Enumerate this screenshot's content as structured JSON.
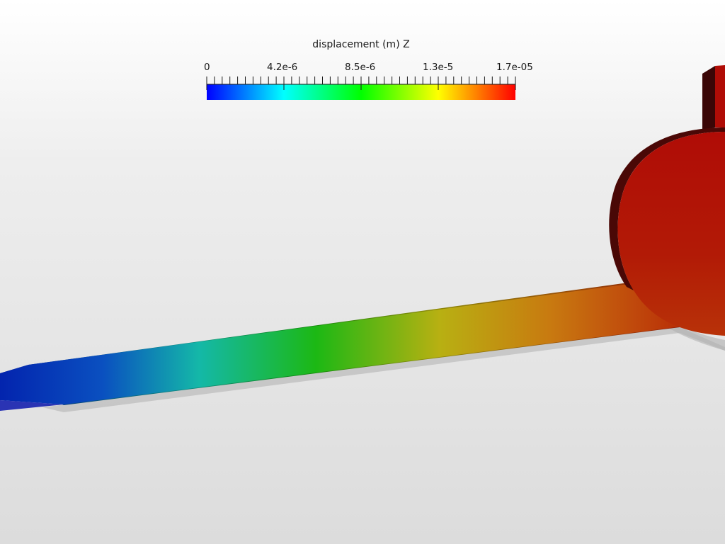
{
  "colorbar": {
    "title": "displacement (m) Z",
    "tick_labels": [
      "0",
      "4.2e-6",
      "8.5e-6",
      "1.3e-5",
      "1.7e-05"
    ],
    "range": [
      0,
      1.7e-05
    ],
    "colormap": [
      "#0000ff",
      "#00ffff",
      "#00ff00",
      "#ffff00",
      "#ff0000"
    ]
  },
  "scene": {
    "background_top": "#ffffff",
    "background_bottom": "#dcdcdc",
    "beam_colors": {
      "start": "#0324ae",
      "cyan": "#14b8a8",
      "green": "#1cb814",
      "yellow": "#b8b012",
      "orange": "#c05a10",
      "end": "#b41a06"
    },
    "disc_color": "#b01006"
  }
}
